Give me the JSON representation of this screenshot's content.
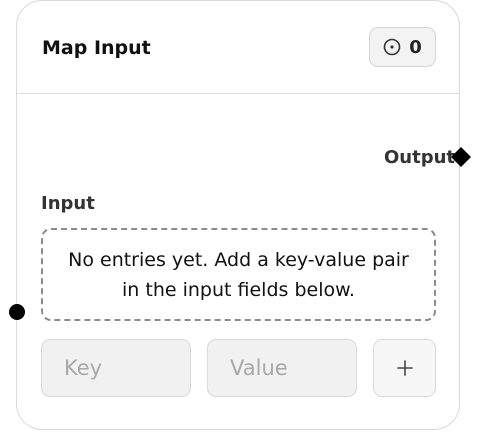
{
  "node": {
    "title": "Map Input",
    "run_count": "0",
    "run_icon": "circle-dot-icon"
  },
  "ports": {
    "output_label": "Output",
    "input_label": "Input"
  },
  "entries": {
    "empty_message": "No entries yet. Add a key-value pair in the input fields below.",
    "items": []
  },
  "form": {
    "key_placeholder": "Key",
    "key_value": "",
    "value_placeholder": "Value",
    "value_value": "",
    "add_icon": "plus-icon"
  }
}
